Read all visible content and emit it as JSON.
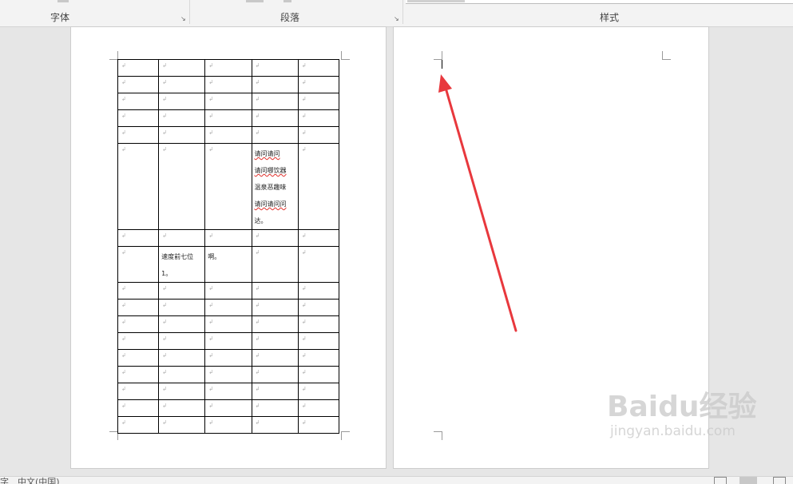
{
  "ribbon": {
    "font_group": "字体",
    "paragraph_group": "段落",
    "styles_group": "样式",
    "launcher_glyph": "↘"
  },
  "table": {
    "empty_mark": "↲",
    "merged_text": [
      "请问请问",
      "请问哪饮器",
      "温泉恶趣味",
      "请问请问问",
      "达。"
    ],
    "speed_text": [
      "速度前七位",
      "1。"
    ],
    "ah_text": "啊。"
  },
  "annotation": {
    "arrow_color": "#e8383d"
  },
  "status": {
    "left_fragment": "字",
    "language": "中文(中国)"
  },
  "watermark": {
    "brand": "Baidu经验",
    "url": "jingyan.baidu.com"
  }
}
